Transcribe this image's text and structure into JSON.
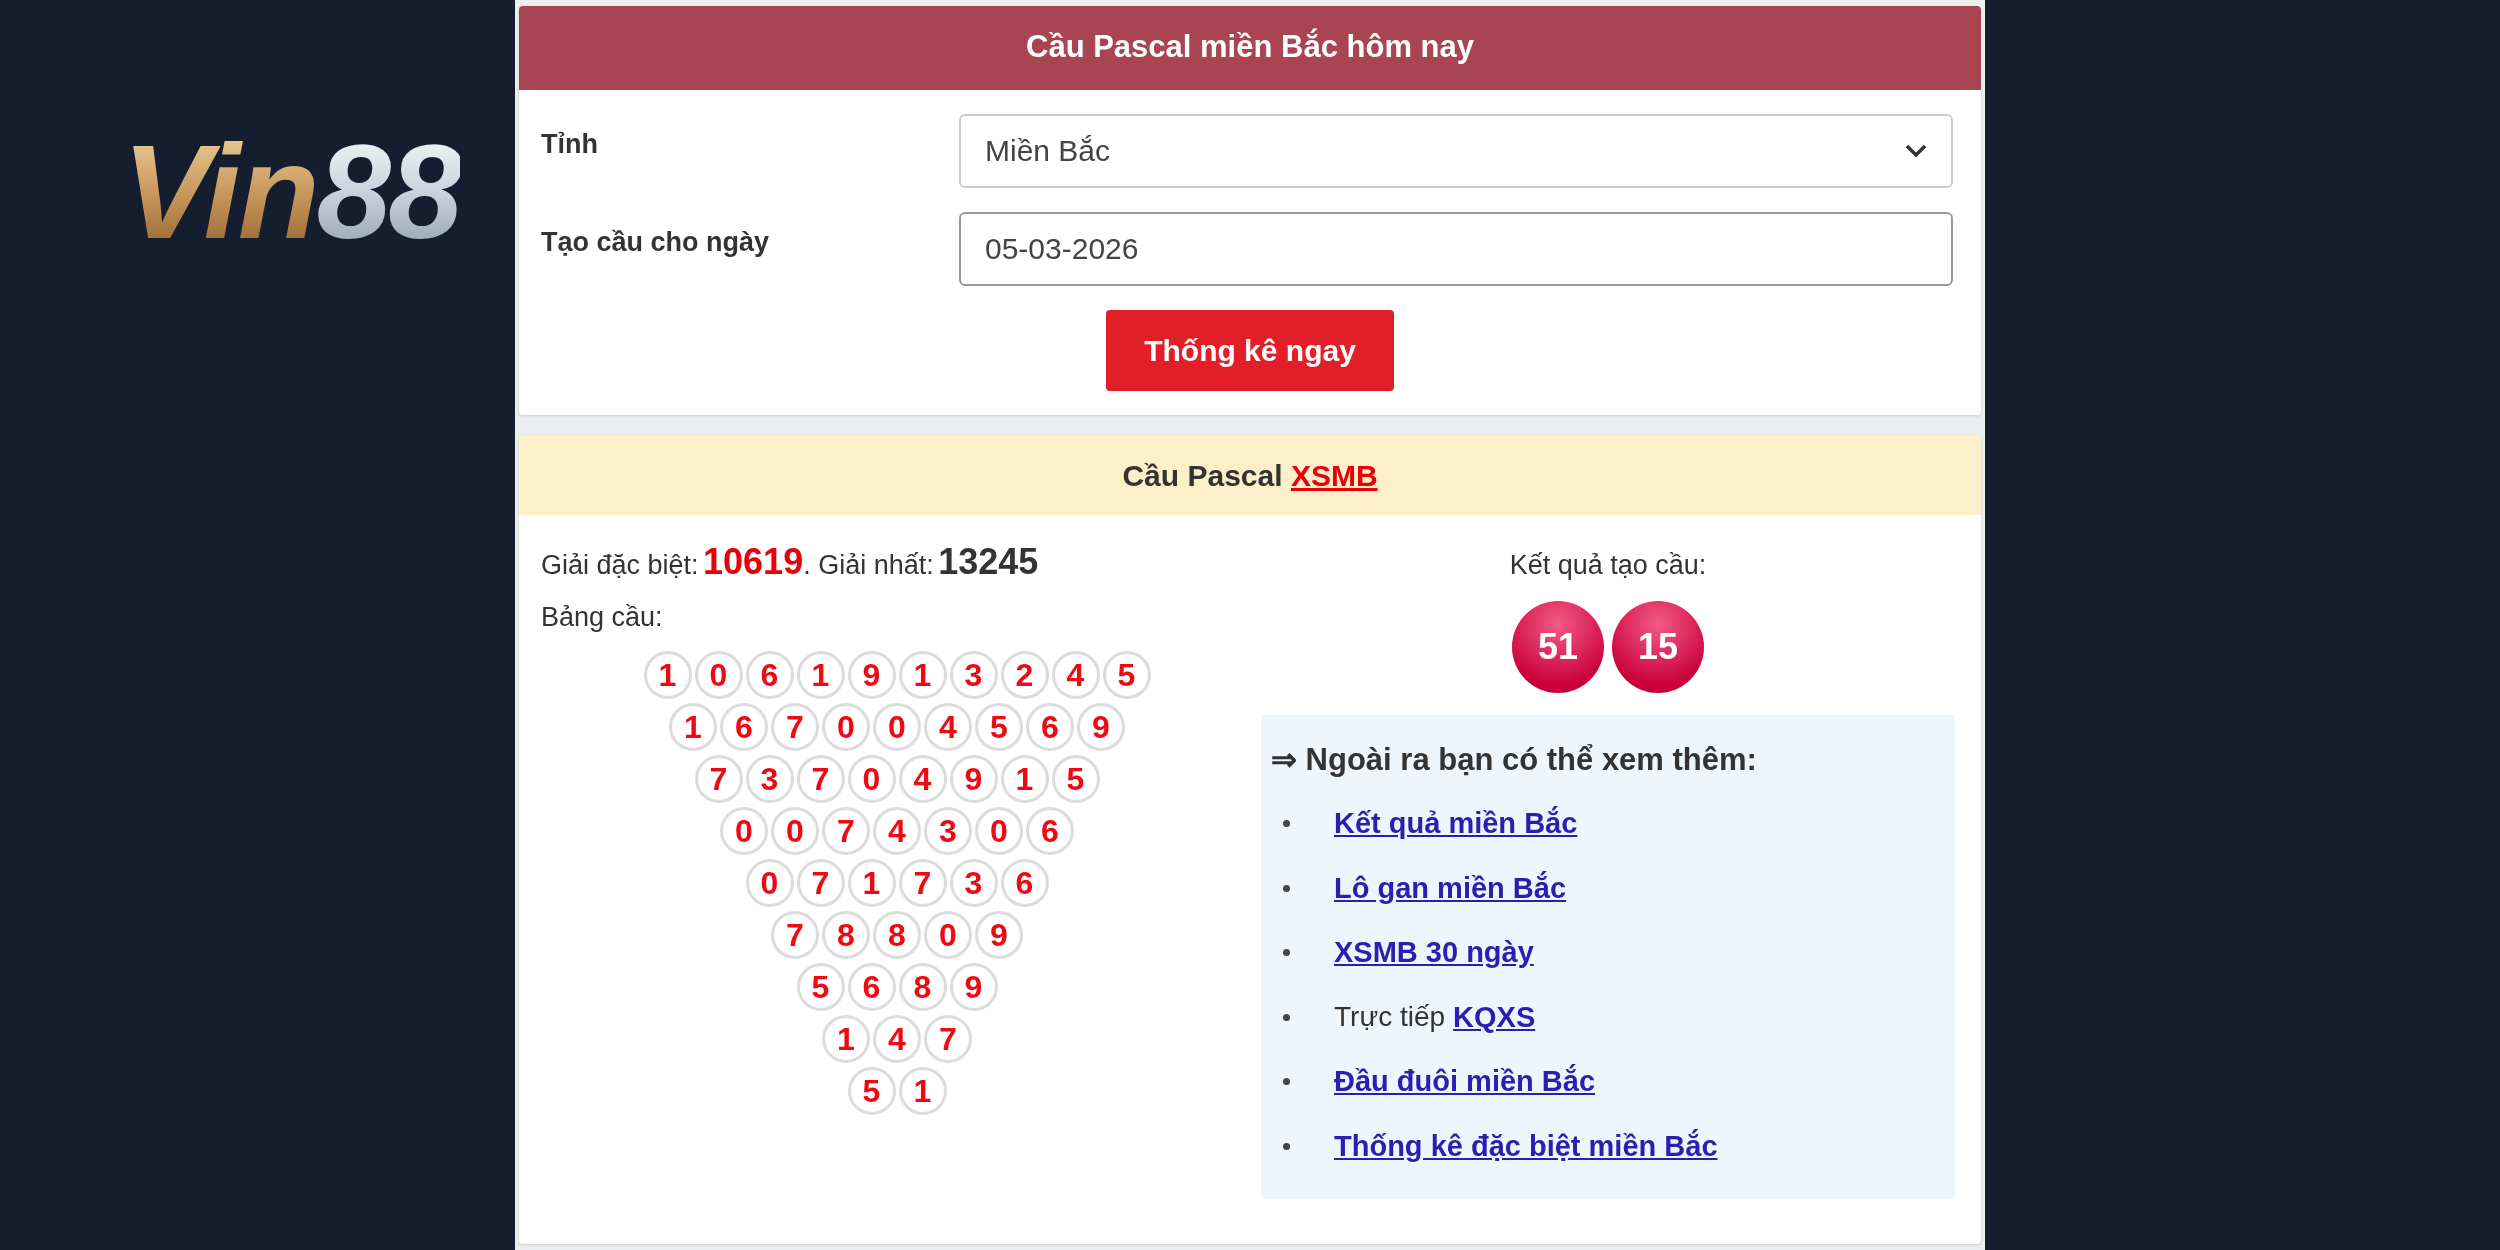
{
  "logo": {
    "part_gold": "Vin",
    "part_silver": "88"
  },
  "form_card": {
    "title": "Cầu Pascal miền Bắc hôm nay",
    "fields": [
      {
        "kind": "select",
        "label": "Tỉnh",
        "value": "Miền Bắc"
      },
      {
        "kind": "input",
        "label": "Tạo cầu cho ngày",
        "value": "05-03-2026"
      }
    ],
    "button": "Thống kê ngay"
  },
  "result_card": {
    "title": "Cầu Pascal",
    "title_link": "XSMB",
    "special_label": "Giải đặc biệt:",
    "special_value": "10619",
    "first_label": ". Giải nhất:",
    "first_value": "13245",
    "table_label": "Bảng cầu:",
    "rows": [
      [
        "1",
        "0",
        "6",
        "1",
        "9",
        "1",
        "3",
        "2",
        "4",
        "5"
      ],
      [
        "1",
        "6",
        "7",
        "0",
        "0",
        "4",
        "5",
        "6",
        "9"
      ],
      [
        "7",
        "3",
        "7",
        "0",
        "4",
        "9",
        "1",
        "5"
      ],
      [
        "0",
        "0",
        "7",
        "4",
        "3",
        "0",
        "6"
      ],
      [
        "0",
        "7",
        "1",
        "7",
        "3",
        "6"
      ],
      [
        "7",
        "8",
        "8",
        "0",
        "9"
      ],
      [
        "5",
        "6",
        "8",
        "9"
      ],
      [
        "1",
        "4",
        "7"
      ],
      [
        "5",
        "1"
      ]
    ],
    "result_label": "Kết quả tạo cầu:",
    "result_balls": [
      "51",
      "15"
    ],
    "more": {
      "heading": "⇒ Ngoài ra bạn có thể xem thêm:",
      "items": [
        {
          "link": "Kết quả miền Bắc"
        },
        {
          "link": "Lô gan miền Bắc"
        },
        {
          "link": "XSMB 30 ngày"
        },
        {
          "prefix": "Trực tiếp",
          "link": "KQXS"
        },
        {
          "link": "Đầu đuôi miền Bắc"
        },
        {
          "link": "Thống kê đặc biệt miền Bắc"
        }
      ]
    }
  }
}
